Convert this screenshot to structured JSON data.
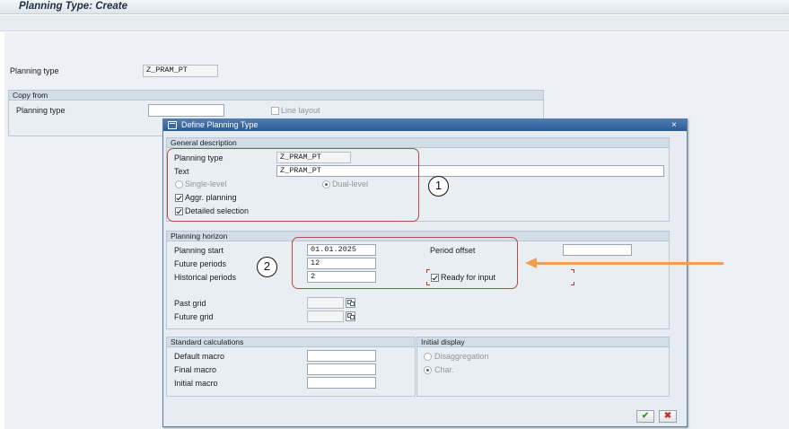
{
  "window": {
    "title": "Planning Type: Create"
  },
  "main": {
    "planning_type_label": "Planning type",
    "planning_type_value": "Z_PRAM_PT",
    "copy_from": {
      "title": "Copy from",
      "planning_type_label": "Planning type",
      "planning_type_value": "",
      "line_layout_label": "Line layout",
      "line_layout_checked": false
    }
  },
  "dialog": {
    "title": "Define Planning Type",
    "icon": "dialog-window-icon",
    "close_label": "×",
    "general": {
      "title": "General description",
      "planning_type_label": "Planning type",
      "planning_type_value": "Z_PRAM_PT",
      "text_label": "Text",
      "text_value": "Z_PRAM_PT",
      "single_level_label": "Single-level",
      "dual_level_label": "Dual-level",
      "selected_level": "Dual-level",
      "aggr_planning_label": "Aggr. planning",
      "aggr_planning_checked": true,
      "detailed_selection_label": "Detailed selection",
      "detailed_selection_checked": true
    },
    "horizon": {
      "title": "Planning horizon",
      "planning_start_label": "Planning start",
      "planning_start_value": "01.01.2025",
      "future_periods_label": "Future periods",
      "future_periods_value": "12",
      "historical_periods_label": "Historical periods",
      "historical_periods_value": "2",
      "period_offset_label": "Period offset",
      "period_offset_value": "",
      "ready_for_input_label": "Ready for input",
      "ready_for_input_checked": true,
      "past_grid_label": "Past grid",
      "future_grid_label": "Future grid"
    },
    "standard_calc": {
      "title": "Standard calculations",
      "default_macro_label": "Default macro",
      "final_macro_label": "Final macro",
      "initial_macro_label": "Initial macro"
    },
    "initial_display": {
      "title": "Initial display",
      "disaggregation_label": "Disaggregation",
      "char_label": "Char.",
      "selected": "Char."
    },
    "buttons": {
      "ok_icon": "✔",
      "cancel_icon": "✖"
    }
  },
  "annotations": {
    "marker_1": "1",
    "marker_2": "2",
    "arrow_color": "#f0a050",
    "highlight_color": "#b54b4b"
  }
}
